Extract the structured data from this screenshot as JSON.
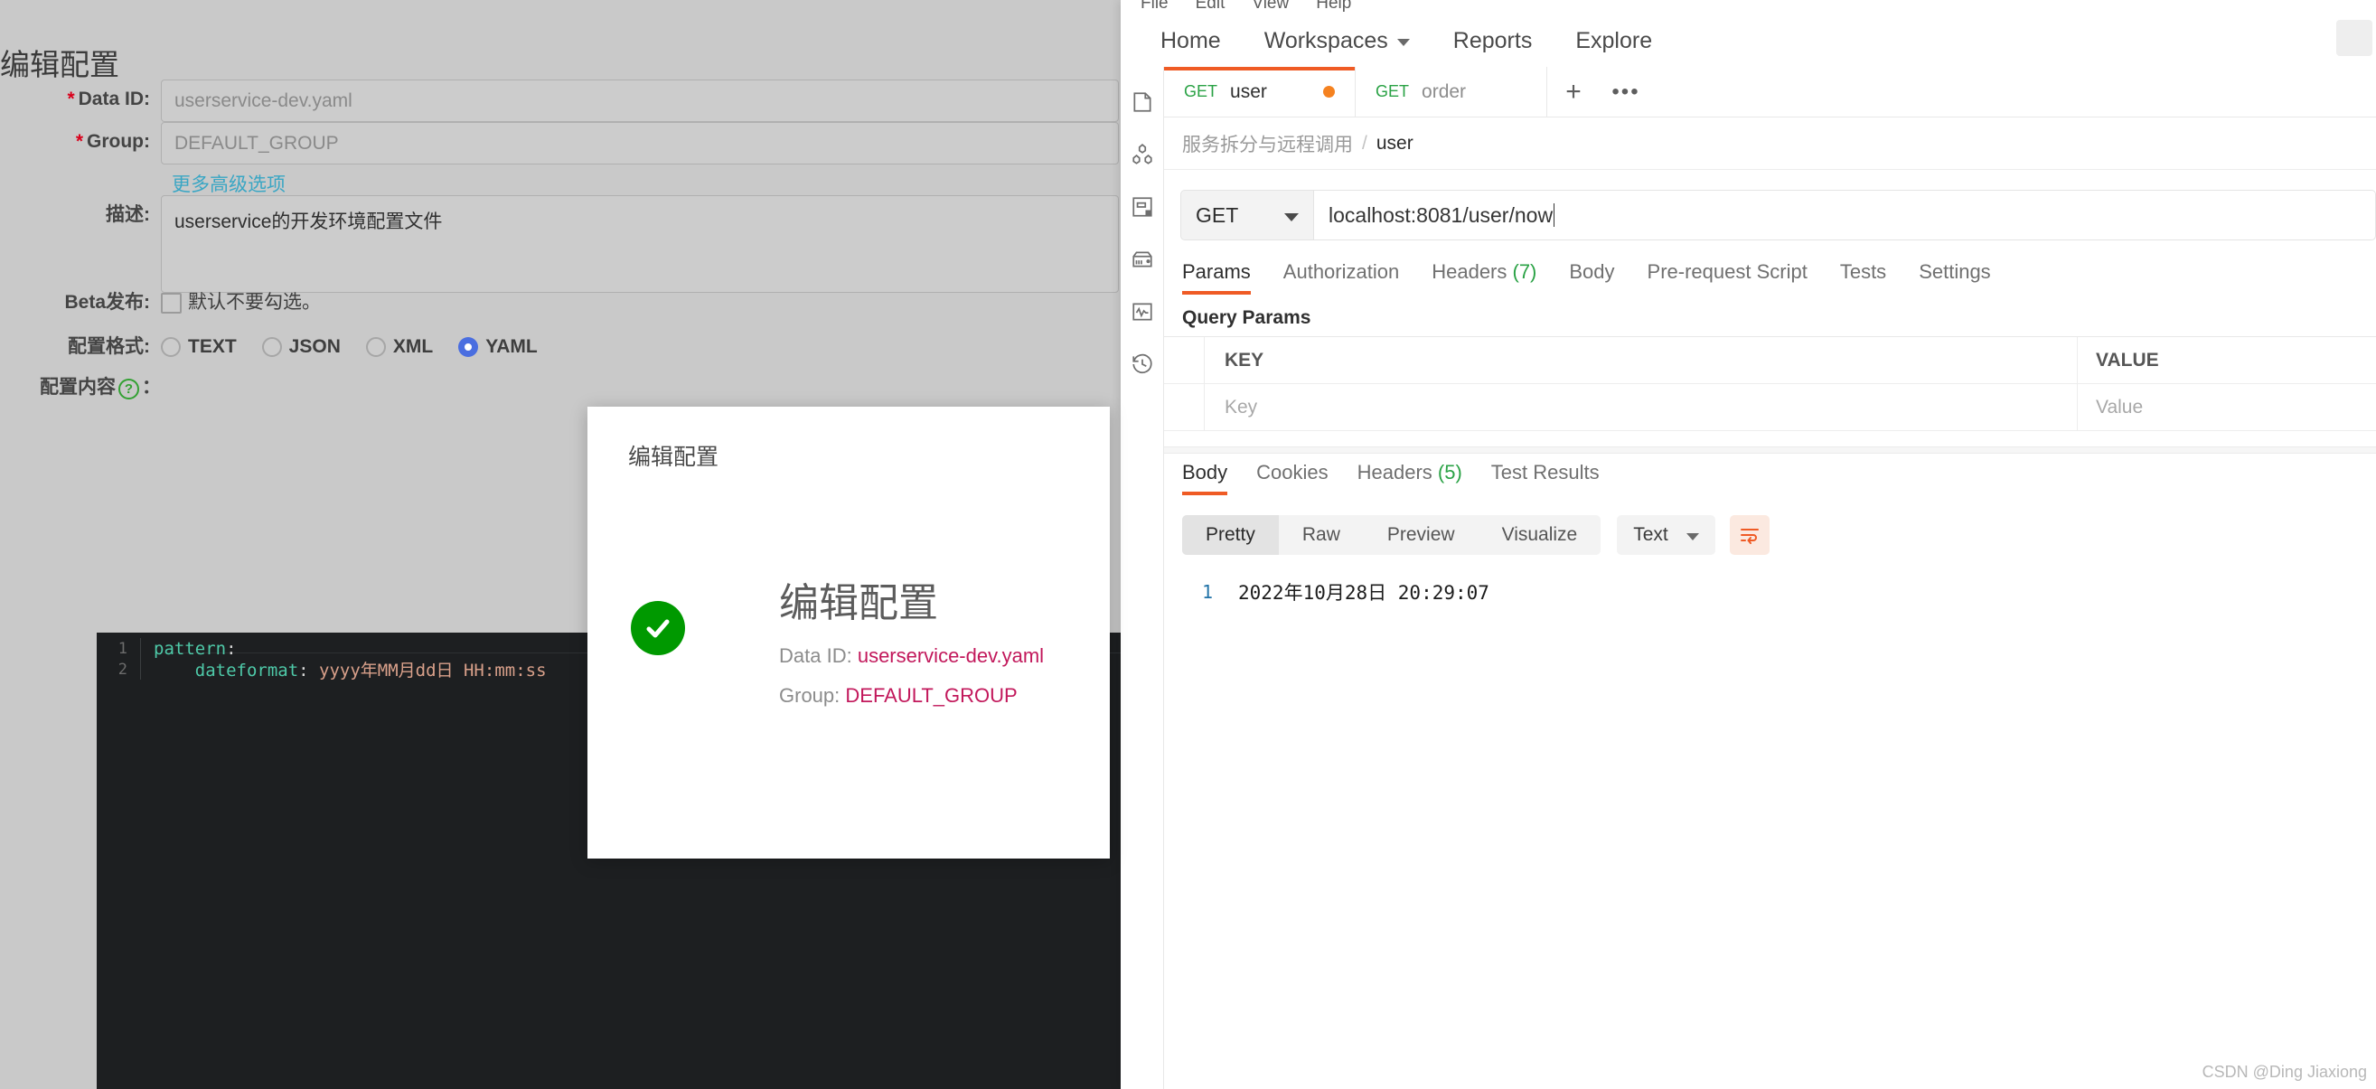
{
  "nacos": {
    "page_title": "编辑配置",
    "fields": {
      "data_id_label": "Data ID:",
      "data_id_value": "userservice-dev.yaml",
      "group_label": "Group:",
      "group_value": "DEFAULT_GROUP",
      "advanced_link": "更多高级选项",
      "desc_label": "描述:",
      "desc_value": "userservice的开发环境配置文件",
      "beta_label": "Beta发布:",
      "beta_hint": "默认不要勾选。",
      "format_label": "配置格式:",
      "content_label": "配置内容",
      "content_label_suffix": "："
    },
    "format_options": [
      {
        "label": "TEXT",
        "selected": false
      },
      {
        "label": "JSON",
        "selected": false
      },
      {
        "label": "XML",
        "selected": false
      },
      {
        "label": "YAML",
        "selected": true
      }
    ],
    "code": [
      {
        "num": "1",
        "indent": "",
        "key": "pattern",
        "colon": ":",
        "value": ""
      },
      {
        "num": "2",
        "indent": "    ",
        "key": "dateformat",
        "colon": ": ",
        "value": "yyyy年MM月dd日 HH:mm:ss"
      }
    ],
    "help_icon_glyph": "?"
  },
  "modal": {
    "header_title": "编辑配置",
    "big_title": "编辑配置",
    "data_id_label": "Data ID:",
    "data_id_value": "userservice-dev.yaml",
    "group_label": "Group:",
    "group_value": "DEFAULT_GROUP",
    "success_color": "#009900",
    "value_color": "#c2185b"
  },
  "postman": {
    "menubar": [
      "File",
      "Edit",
      "View",
      "Help"
    ],
    "nav": [
      {
        "label": "Home",
        "caret": false
      },
      {
        "label": "Workspaces",
        "caret": true
      },
      {
        "label": "Reports",
        "caret": false
      },
      {
        "label": "Explore",
        "caret": false
      }
    ],
    "sidebar_icons": [
      "collections-icon",
      "apis-icon",
      "environments-icon",
      "mock-servers-icon",
      "monitors-icon",
      "history-icon"
    ],
    "tabs": [
      {
        "method": "GET",
        "name": "user",
        "active": true,
        "unsaved": true
      },
      {
        "method": "GET",
        "name": "order",
        "active": false,
        "unsaved": false
      }
    ],
    "tab_add_label": "+",
    "tab_more_label": "•••",
    "breadcrumb": {
      "collection": "服务拆分与远程调用",
      "separator": "/",
      "current": "user"
    },
    "request": {
      "method": "GET",
      "url": "localhost:8081/user/now",
      "tabs": [
        {
          "label": "Params",
          "count": "",
          "active": true
        },
        {
          "label": "Authorization",
          "count": "",
          "active": false
        },
        {
          "label": "Headers",
          "count": "(7)",
          "active": false
        },
        {
          "label": "Body",
          "count": "",
          "active": false
        },
        {
          "label": "Pre-request Script",
          "count": "",
          "active": false
        },
        {
          "label": "Tests",
          "count": "",
          "active": false
        },
        {
          "label": "Settings",
          "count": "",
          "active": false
        }
      ],
      "query_params_title": "Query Params",
      "table": {
        "headers": {
          "key": "KEY",
          "value": "VALUE"
        },
        "row_placeholders": {
          "key": "Key",
          "value": "Value"
        }
      }
    },
    "response": {
      "tabs": [
        {
          "label": "Body",
          "count": "",
          "active": true
        },
        {
          "label": "Cookies",
          "count": "",
          "active": false
        },
        {
          "label": "Headers",
          "count": "(5)",
          "active": false
        },
        {
          "label": "Test Results",
          "count": "",
          "active": false
        }
      ],
      "view_modes": [
        {
          "label": "Pretty",
          "active": true
        },
        {
          "label": "Raw",
          "active": false
        },
        {
          "label": "Preview",
          "active": false
        },
        {
          "label": "Visualize",
          "active": false
        }
      ],
      "type_selector": "Text",
      "body_lines": [
        {
          "num": "1",
          "text": "2022年10月28日 20:29:07"
        }
      ]
    },
    "accent_color": "#ef5b25"
  },
  "watermark": "CSDN @Ding Jiaxiong"
}
